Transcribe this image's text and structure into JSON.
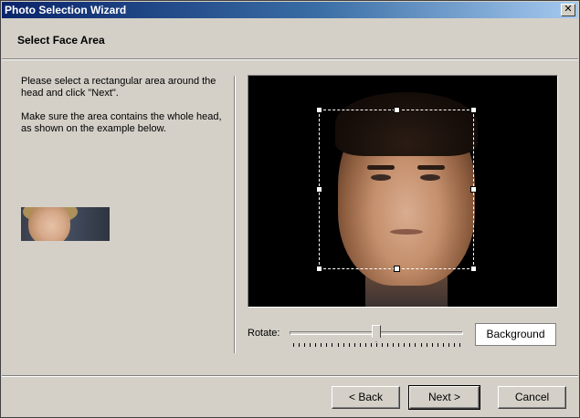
{
  "window": {
    "title": "Photo Selection Wizard",
    "close_glyph": "✕"
  },
  "header": {
    "title": "Select Face Area"
  },
  "instructions": {
    "line1": "Please select a rectangular area around the head and click \"Next\".",
    "line2": "Make sure the area contains the whole head, as shown on the example below."
  },
  "controls": {
    "rotate_label": "Rotate:",
    "background_button": "Background",
    "rotate_value": 0.5
  },
  "footer": {
    "back_label": "< Back",
    "next_label": "Next >",
    "cancel_label": "Cancel"
  },
  "colors": {
    "title_bar": "#0a246a",
    "dialog_bg": "#d4d0c8"
  }
}
